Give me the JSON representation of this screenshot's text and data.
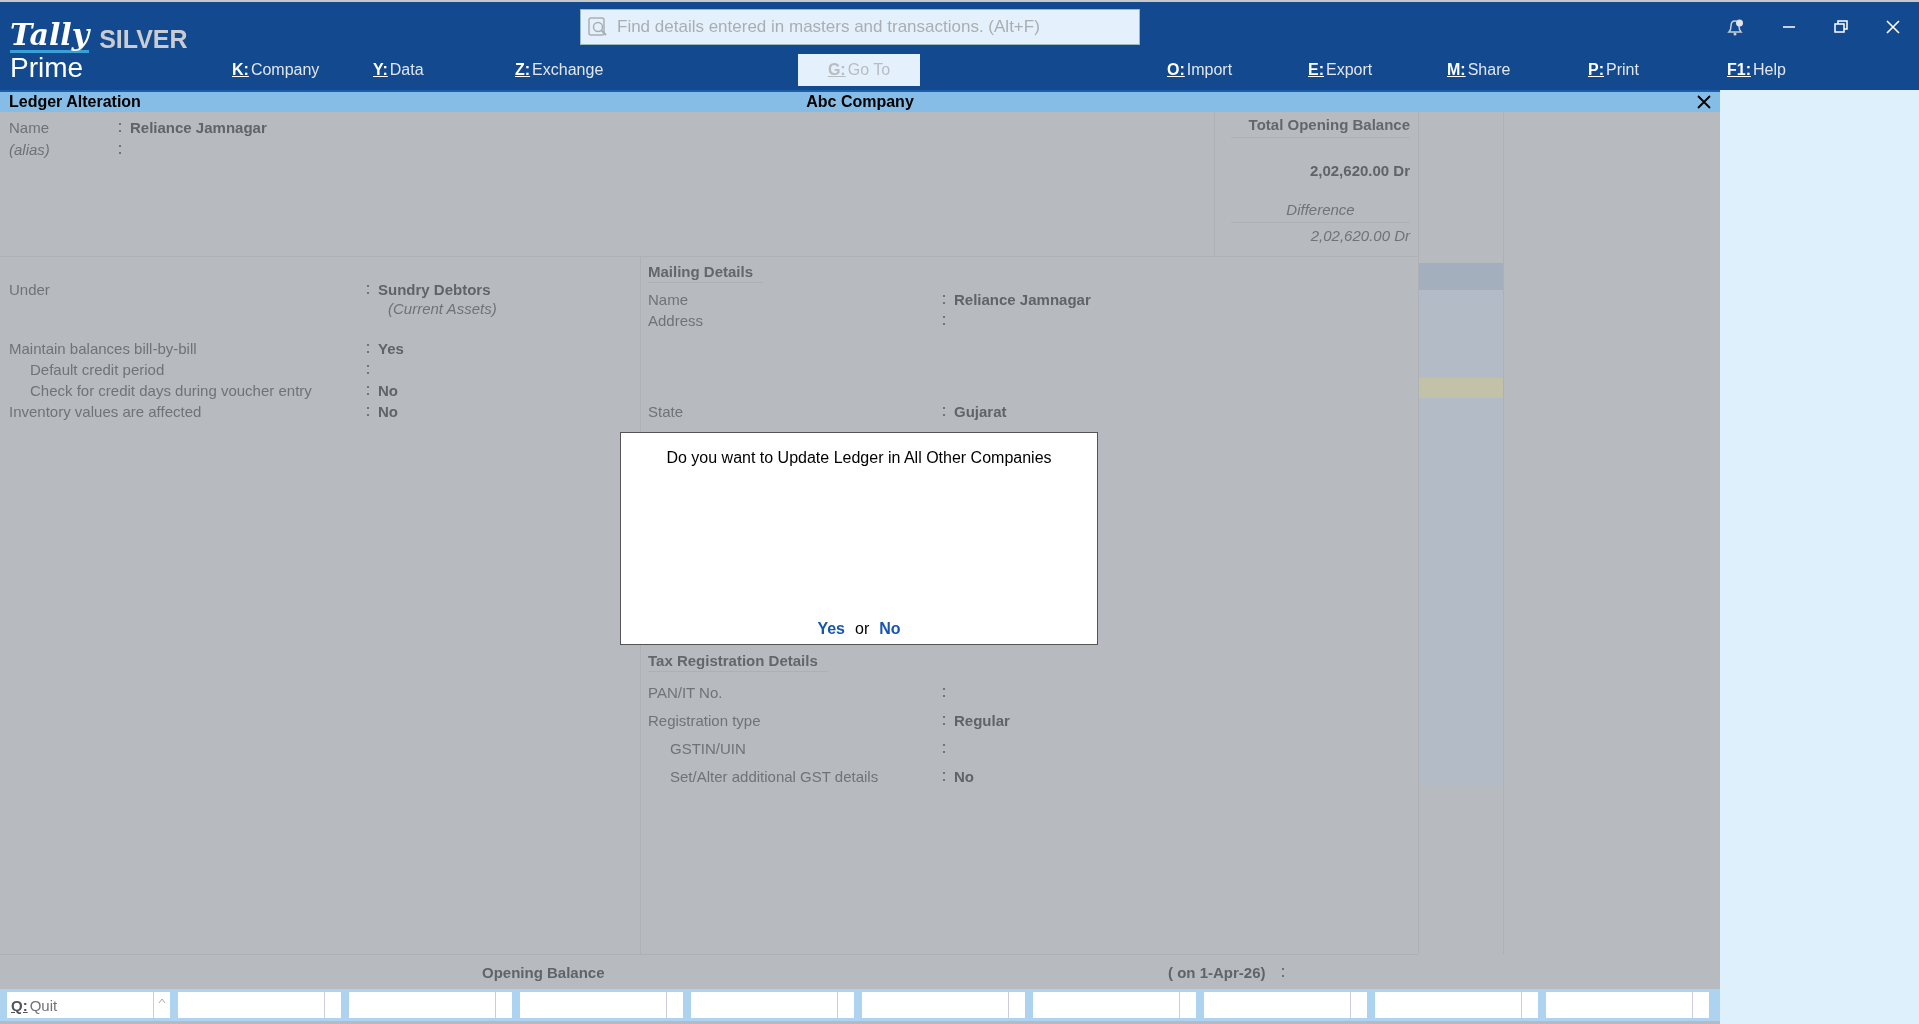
{
  "logo": {
    "brand": "Tally",
    "product": "Prime",
    "edition": "SILVER"
  },
  "search": {
    "placeholder": "Find details entered in masters and transactions. (Alt+F)"
  },
  "menu": [
    {
      "key": "K:",
      "label": "Company",
      "disabled": false
    },
    {
      "key": "Y:",
      "label": "Data",
      "disabled": false
    },
    {
      "key": "Z:",
      "label": "Exchange",
      "disabled": false
    },
    {
      "key": "G:",
      "label": "Go To",
      "disabled": true
    },
    {
      "key": "O:",
      "label": "Import",
      "disabled": false
    },
    {
      "key": "E:",
      "label": "Export",
      "disabled": false
    },
    {
      "key": "M:",
      "label": "Share",
      "disabled": false
    },
    {
      "key": "P:",
      "label": "Print",
      "disabled": false
    },
    {
      "key": "F1:",
      "label": "Help",
      "disabled": false
    }
  ],
  "screen": {
    "title": "Ledger Alteration",
    "company": "Abc Company"
  },
  "top_fields": [
    {
      "label": "Name",
      "value": "Reliance Jamnagar",
      "italic": false
    },
    {
      "label": "(alias)",
      "italic": true
    }
  ],
  "balance_box": {
    "title": "Total Opening Balance",
    "amount": "2,02,620.00 Dr",
    "difference_label": "Difference",
    "difference_amount": "2,02,620.00 Dr"
  },
  "left_fields": [
    {
      "label": "Under",
      "value": "Sundry Debtors",
      "note": "(Current Assets)"
    },
    {
      "label": "Maintain balances bill-by-bill",
      "value": "Yes",
      "children": [
        {
          "label": "Default credit period"
        },
        {
          "label": "Check for credit days during voucher entry",
          "value": "No"
        }
      ]
    },
    {
      "label": "Inventory values are affected",
      "value": "No"
    }
  ],
  "mailing": {
    "title": "Mailing Details",
    "fields": [
      {
        "label": "Name",
        "value": "Reliance Jamnagar"
      },
      {
        "label": "Address"
      },
      {
        "label": "State",
        "value": "Gujarat"
      }
    ]
  },
  "tax": {
    "title": "Tax Registration Details",
    "fields": [
      {
        "label": "PAN/IT No."
      },
      {
        "label": "Registration type",
        "value": "Regular",
        "children": [
          {
            "label": "GSTIN/UIN"
          },
          {
            "label": "Set/Alter additional GST details",
            "value": "No"
          }
        ]
      }
    ]
  },
  "opening": {
    "label": "Opening Balance",
    "date": "( on 1-Apr-26)"
  },
  "dialog": {
    "message": "Do you want to Update Ledger in All Other Companies",
    "yes": "Yes",
    "or": "or",
    "no": "No"
  },
  "footer_buttons": [
    {
      "key": "Q:",
      "label": "Quit"
    }
  ]
}
